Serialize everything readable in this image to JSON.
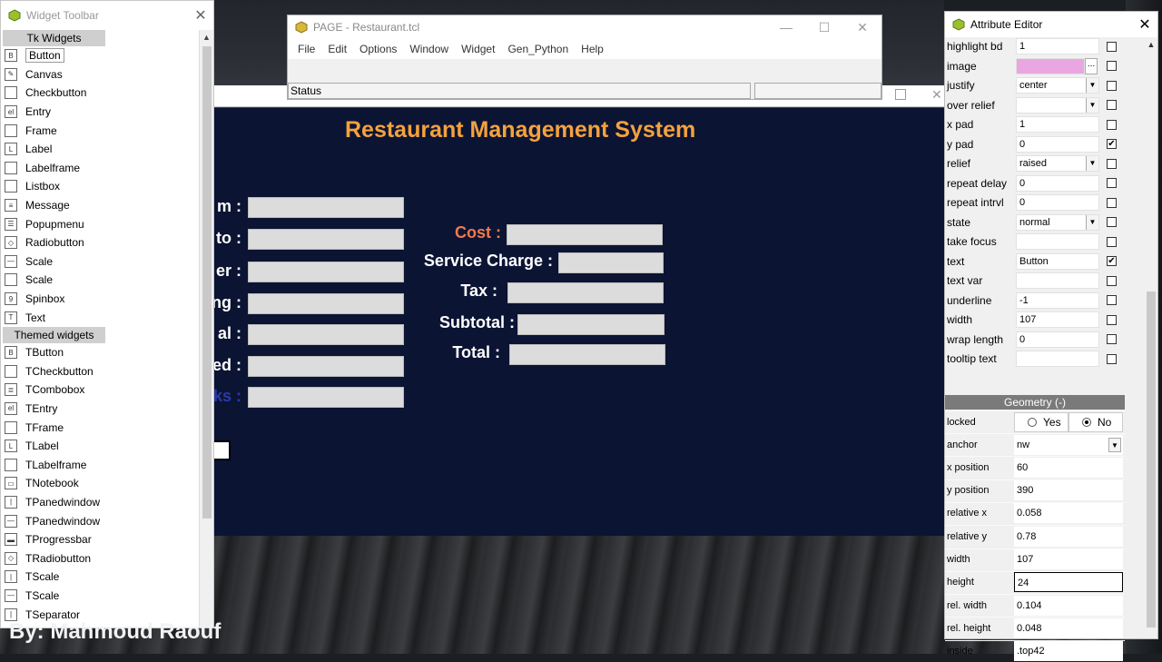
{
  "toolbar": {
    "title": "Widget Toolbar",
    "tk_header": "Tk Widgets",
    "tk_items": [
      {
        "label": "Button",
        "icon": "button-icon",
        "glyph": "B",
        "selected": true
      },
      {
        "label": "Canvas",
        "icon": "canvas-icon",
        "glyph": "✎"
      },
      {
        "label": "Checkbutton",
        "icon": "checkbutton-icon",
        "glyph": ""
      },
      {
        "label": "Entry",
        "icon": "entry-icon",
        "glyph": "el"
      },
      {
        "label": "Frame",
        "icon": "frame-icon",
        "glyph": ""
      },
      {
        "label": "Label",
        "icon": "label-icon",
        "glyph": "L"
      },
      {
        "label": "Labelframe",
        "icon": "labelframe-icon",
        "glyph": ""
      },
      {
        "label": "Listbox",
        "icon": "listbox-icon",
        "glyph": ""
      },
      {
        "label": "Message",
        "icon": "message-icon",
        "glyph": "≡"
      },
      {
        "label": "Popupmenu",
        "icon": "popupmenu-icon",
        "glyph": "☰"
      },
      {
        "label": "Radiobutton",
        "icon": "radiobutton-icon",
        "glyph": "◇"
      },
      {
        "label": "Scale",
        "icon": "scale-icon",
        "glyph": "—"
      },
      {
        "label": "Scale",
        "icon": "scale-icon",
        "glyph": ""
      },
      {
        "label": "Spinbox",
        "icon": "spinbox-icon",
        "glyph": "9"
      },
      {
        "label": "Text",
        "icon": "text-icon",
        "glyph": "T"
      }
    ],
    "themed_header": "Themed widgets",
    "themed_items": [
      {
        "label": "TButton",
        "icon": "tbutton-icon",
        "glyph": "B"
      },
      {
        "label": "TCheckbutton",
        "icon": "tcheckbutton-icon",
        "glyph": ""
      },
      {
        "label": "TCombobox",
        "icon": "tcombobox-icon",
        "glyph": "≣"
      },
      {
        "label": "TEntry",
        "icon": "tentry-icon",
        "glyph": "el"
      },
      {
        "label": "TFrame",
        "icon": "tframe-icon",
        "glyph": ""
      },
      {
        "label": "TLabel",
        "icon": "tlabel-icon",
        "glyph": "L"
      },
      {
        "label": "TLabelframe",
        "icon": "tlabelframe-icon",
        "glyph": ""
      },
      {
        "label": "TNotebook",
        "icon": "tnotebook-icon",
        "glyph": "▭"
      },
      {
        "label": "TPanedwindow",
        "icon": "tpanedwindow-icon",
        "glyph": "|"
      },
      {
        "label": "TPanedwindow",
        "icon": "tpanedwindow-icon",
        "glyph": "—"
      },
      {
        "label": "TProgressbar",
        "icon": "tprogressbar-icon",
        "glyph": "▬"
      },
      {
        "label": "TRadiobutton",
        "icon": "tradiobutton-icon",
        "glyph": "◇"
      },
      {
        "label": "TScale",
        "icon": "tscale-icon",
        "glyph": "|"
      },
      {
        "label": "TScale",
        "icon": "tscale-icon",
        "glyph": "—"
      },
      {
        "label": "TSeparator",
        "icon": "tseparator-icon",
        "glyph": "|"
      }
    ],
    "signature": "By: Mahmoud Raouf"
  },
  "page_window": {
    "title": "PAGE - Restaurant.tcl",
    "menu": [
      "File",
      "Edit",
      "Options",
      "Window",
      "Widget",
      "Gen_Python",
      "Help"
    ],
    "status": "Status"
  },
  "form": {
    "title": "Restaurant Management System",
    "left_labels": [
      "m :",
      "to :",
      "er :",
      "ng :",
      "al :",
      "ed :",
      "ks :"
    ],
    "right_labels": {
      "cost": "Cost :",
      "service": "Service Charge :",
      "tax": "Tax :",
      "subtotal": "Subtotal :",
      "total": "Total :"
    }
  },
  "attr_editor": {
    "title": "Attribute Editor",
    "rows": [
      {
        "name": "highlight bd",
        "value": "1",
        "type": "text",
        "checked": false
      },
      {
        "name": "image",
        "value": "",
        "type": "image",
        "checked": false
      },
      {
        "name": "justify",
        "value": "center",
        "type": "combo",
        "checked": false
      },
      {
        "name": "over relief",
        "value": "",
        "type": "combo",
        "checked": false
      },
      {
        "name": "x pad",
        "value": "1",
        "type": "text",
        "checked": false
      },
      {
        "name": "y pad",
        "value": "0",
        "type": "text",
        "checked": true
      },
      {
        "name": "relief",
        "value": "raised",
        "type": "combo",
        "checked": false
      },
      {
        "name": "repeat delay",
        "value": "0",
        "type": "text",
        "checked": false
      },
      {
        "name": "repeat intrvl",
        "value": "0",
        "type": "text",
        "checked": false
      },
      {
        "name": "state",
        "value": "normal",
        "type": "combo",
        "checked": false
      },
      {
        "name": "take focus",
        "value": "",
        "type": "text",
        "checked": false
      },
      {
        "name": "text",
        "value": "Button",
        "type": "text",
        "checked": true
      },
      {
        "name": "text var",
        "value": "",
        "type": "text",
        "checked": false
      },
      {
        "name": "underline",
        "value": "-1",
        "type": "text",
        "checked": false
      },
      {
        "name": "width",
        "value": "107",
        "type": "text",
        "checked": false
      },
      {
        "name": "wrap length",
        "value": "0",
        "type": "text",
        "checked": false
      },
      {
        "name": "tooltip text",
        "value": "",
        "type": "text",
        "checked": false
      }
    ],
    "geometry_header": "Geometry (-)",
    "locked": {
      "label": "locked",
      "yes": "Yes",
      "no": "No",
      "selected": "No"
    },
    "geometry": [
      {
        "name": "anchor",
        "value": "nw",
        "type": "combo"
      },
      {
        "name": "x position",
        "value": "60",
        "type": "text"
      },
      {
        "name": "y position",
        "value": "390",
        "type": "text"
      },
      {
        "name": "relative x",
        "value": "0.058",
        "type": "text"
      },
      {
        "name": "relative y",
        "value": "0.78",
        "type": "text"
      },
      {
        "name": "width",
        "value": "107",
        "type": "text"
      },
      {
        "name": "height",
        "value": "24",
        "type": "text",
        "active": true
      },
      {
        "name": "rel. width",
        "value": "0.104",
        "type": "text"
      },
      {
        "name": "rel. height",
        "value": "0.048",
        "type": "text"
      },
      {
        "name": "inside",
        "value": ".top42",
        "type": "text"
      }
    ]
  }
}
